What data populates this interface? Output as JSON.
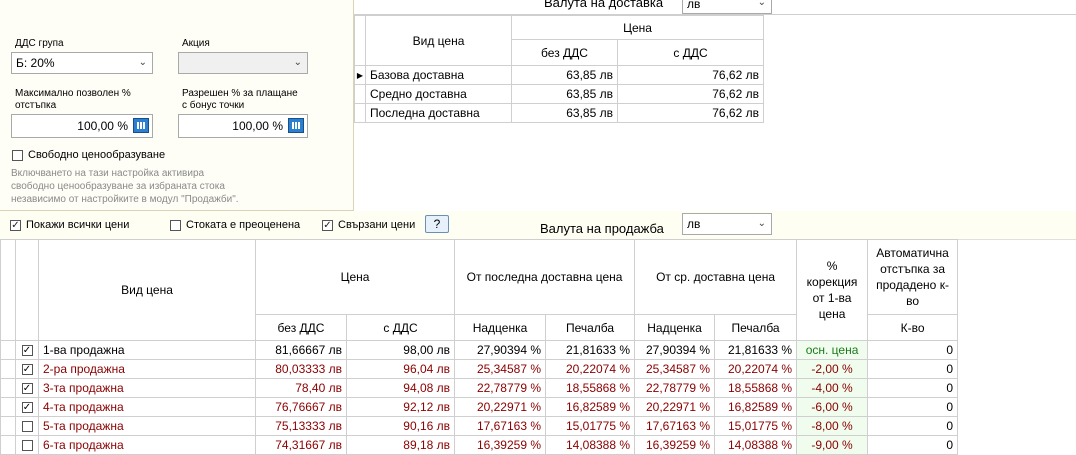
{
  "vat_group": {
    "label": "ДДС група",
    "value": "Б: 20%"
  },
  "promotion": {
    "label": "Акция",
    "value": ""
  },
  "max_discount": {
    "label_line1": "Максимално позволен %",
    "label_line2": "отстъпка",
    "value": "100,00 %"
  },
  "bonus_points": {
    "label_line1": "Разрешен % за плащане",
    "label_line2": "с бонус точки",
    "value": "100,00 %"
  },
  "free_pricing": {
    "label": "Свободно ценообразуване",
    "checked": false,
    "note_line1": "Включването на тази настройка активира",
    "note_line2": "свободно ценообразуване за избраната стока",
    "note_line3": "независимо от настройките в модул \"Продажби\"."
  },
  "delivery_currency": {
    "label": "Валута на доставка",
    "value": "лв"
  },
  "delivery_table": {
    "header_type": "Вид цена",
    "header_price": "Цена",
    "header_excl_vat": "без ДДС",
    "header_incl_vat": "с ДДС",
    "rows": [
      {
        "name": "Базова доставна",
        "excl": "63,85 лв",
        "incl": "76,62 лв",
        "current": true
      },
      {
        "name": "Средно доставна",
        "excl": "63,85 лв",
        "incl": "76,62 лв",
        "current": false
      },
      {
        "name": "Последна доставна",
        "excl": "63,85 лв",
        "incl": "76,62 лв",
        "current": false
      }
    ]
  },
  "options": {
    "show_all_prices": {
      "label": "Покажи всички цени",
      "checked": true
    },
    "repriced": {
      "label": "Стоката е преоценена",
      "checked": false
    },
    "linked_prices": {
      "label": "Свързани цени",
      "checked": true
    },
    "help": "?"
  },
  "sales_currency": {
    "label": "Валута на продажба",
    "value": "лв"
  },
  "sales_table": {
    "header_type": "Вид цена",
    "header_price": "Цена",
    "header_from_last": "От последна доставна цена",
    "header_from_avg": "От ср. доставна цена",
    "header_correction": "% корекция от 1-ва цена",
    "header_auto_discount": "Автоматична отстъпка за продадено к-во",
    "header_excl_vat": "без ДДС",
    "header_incl_vat": "с ДДС",
    "header_markup": "Надценка",
    "header_profit": "Печалба",
    "header_qty": "К-во",
    "rows": [
      {
        "checked": true,
        "name": "1-ва продажна",
        "excl": "81,66667 лв",
        "incl": "98,00 лв",
        "lm": "27,90394 %",
        "lp": "21,81633 %",
        "am": "27,90394 %",
        "ap": "21,81633 %",
        "corr": "осн. цена",
        "qty": "0",
        "red": false
      },
      {
        "checked": true,
        "name": "2-ра продажна",
        "excl": "80,03333 лв",
        "incl": "96,04 лв",
        "lm": "25,34587 %",
        "lp": "20,22074 %",
        "am": "25,34587 %",
        "ap": "20,22074 %",
        "corr": "-2,00 %",
        "qty": "0",
        "red": true
      },
      {
        "checked": true,
        "name": "3-та продажна",
        "excl": "78,40 лв",
        "incl": "94,08 лв",
        "lm": "22,78779 %",
        "lp": "18,55868 %",
        "am": "22,78779 %",
        "ap": "18,55868 %",
        "corr": "-4,00 %",
        "qty": "0",
        "red": true
      },
      {
        "checked": true,
        "name": "4-та продажна",
        "excl": "76,76667 лв",
        "incl": "92,12 лв",
        "lm": "20,22971 %",
        "lp": "16,82589 %",
        "am": "20,22971 %",
        "ap": "16,82589 %",
        "corr": "-6,00 %",
        "qty": "0",
        "red": true
      },
      {
        "checked": false,
        "name": "5-та продажна",
        "excl": "75,13333 лв",
        "incl": "90,16 лв",
        "lm": "17,67163 %",
        "lp": "15,01775 %",
        "am": "17,67163 %",
        "ap": "15,01775 %",
        "corr": "-8,00 %",
        "qty": "0",
        "red": true
      },
      {
        "checked": false,
        "name": "6-та продажна",
        "excl": "74,31667 лв",
        "incl": "89,18 лв",
        "lm": "16,39259 %",
        "lp": "14,08388 %",
        "am": "16,39259 %",
        "ap": "14,08388 %",
        "corr": "-9,00 %",
        "qty": "0",
        "red": true
      }
    ]
  }
}
